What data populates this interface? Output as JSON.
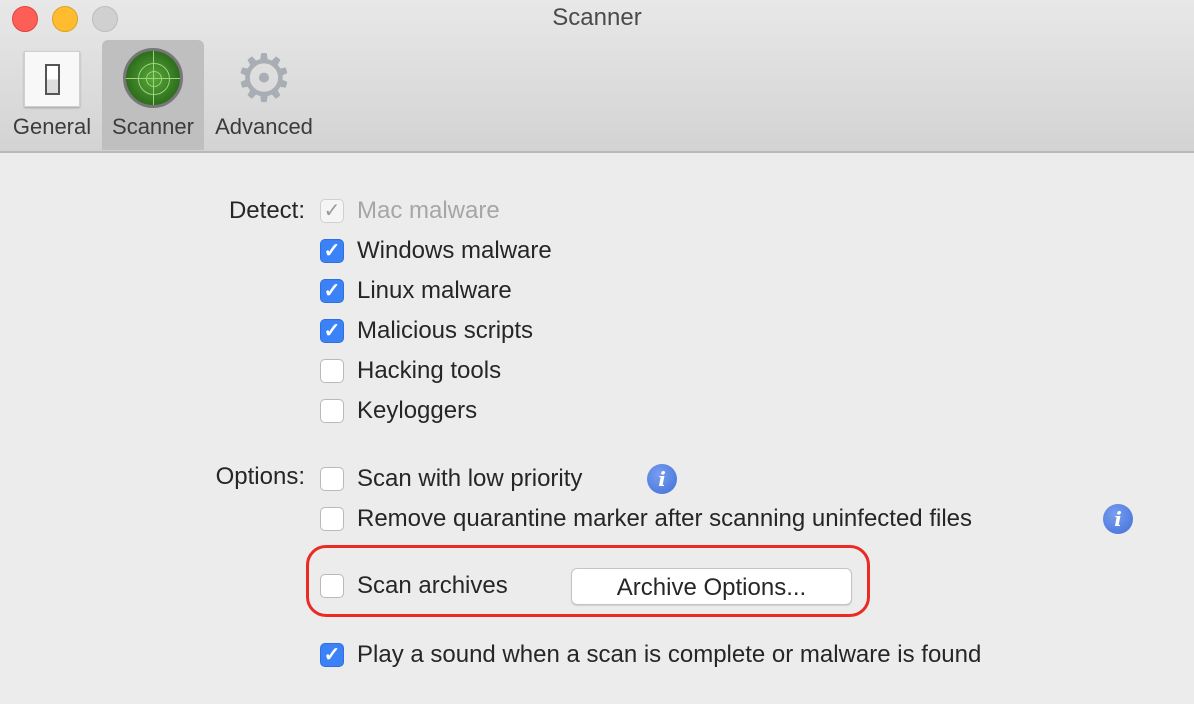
{
  "window": {
    "title": "Scanner"
  },
  "toolbar": {
    "tabs": [
      {
        "label": "General",
        "icon": "light-switch-icon",
        "selected": false
      },
      {
        "label": "Scanner",
        "icon": "radar-icon",
        "selected": true
      },
      {
        "label": "Advanced",
        "icon": "gear-icon",
        "selected": false
      }
    ]
  },
  "detect": {
    "label": "Detect:",
    "items": [
      {
        "label": "Mac malware",
        "checked": true,
        "disabled": true
      },
      {
        "label": "Windows malware",
        "checked": true,
        "disabled": false
      },
      {
        "label": "Linux malware",
        "checked": true,
        "disabled": false
      },
      {
        "label": "Malicious scripts",
        "checked": true,
        "disabled": false
      },
      {
        "label": "Hacking tools",
        "checked": false,
        "disabled": false
      },
      {
        "label": "Keyloggers",
        "checked": false,
        "disabled": false
      }
    ]
  },
  "options": {
    "label": "Options:",
    "low_priority": {
      "label": "Scan with low priority",
      "checked": false
    },
    "remove_quarantine": {
      "label": "Remove quarantine marker after scanning uninfected files",
      "checked": false
    },
    "scan_archives": {
      "label": "Scan archives",
      "checked": false
    },
    "archive_options_button": "Archive Options...",
    "play_sound": {
      "label": "Play a sound when a scan is complete or malware is found",
      "checked": true
    }
  },
  "glyphs": {
    "check": "✓",
    "info": "i",
    "gear": "⚙"
  },
  "colors": {
    "accent": "#3b82f6",
    "highlight": "#ec2a24",
    "info": "#4a78e0"
  }
}
